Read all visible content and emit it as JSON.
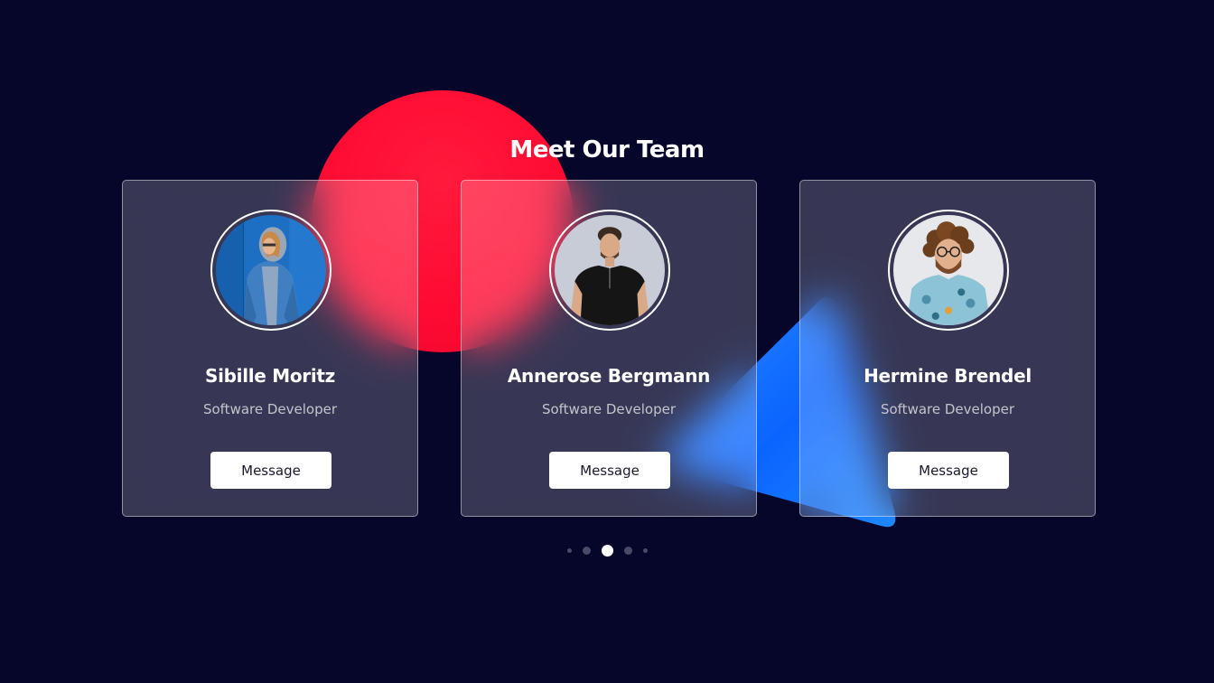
{
  "section": {
    "title": "Meet Our Team"
  },
  "team": [
    {
      "name": "Sibille Moritz",
      "role": "Software Developer",
      "button_label": "Message",
      "avatar_icon": "portrait-woman-denim-hoodie"
    },
    {
      "name": "Annerose Bergmann",
      "role": "Software Developer",
      "button_label": "Message",
      "avatar_icon": "portrait-man-black-tshirt"
    },
    {
      "name": "Hermine Brendel",
      "role": "Software Developer",
      "button_label": "Message",
      "avatar_icon": "portrait-man-curly-hair-floral-shirt"
    }
  ],
  "carousel": {
    "total_dots": 5,
    "active_index": 2
  },
  "colors": {
    "background": "#06062b",
    "accent_red": "#ff0a32",
    "accent_blue": "#1e78ff",
    "card_border": "rgba(255,255,255,0.45)",
    "button_bg": "#ffffff"
  }
}
